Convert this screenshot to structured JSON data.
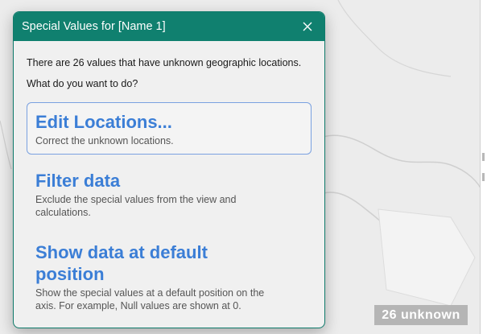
{
  "dialog": {
    "title": "Special Values for [Name 1]",
    "close_icon": "close-icon",
    "message_line1": "There are 26 values that have unknown geographic locations.",
    "message_line2": "What do you want to do?",
    "options": [
      {
        "title": "Edit Locations...",
        "description": "Correct the unknown locations.",
        "selected": true
      },
      {
        "title": "Filter data",
        "description": "Exclude the special values from the view and calculations.",
        "selected": false
      },
      {
        "title": "Show data at default position",
        "description": "Show the special values at a default position on the axis. For example, Null values are shown at 0.",
        "selected": false
      }
    ]
  },
  "map": {
    "unknown_indicator": "26 unknown"
  },
  "colors": {
    "title_bar": "#10806f",
    "option_title": "#3b7ed6",
    "selected_border": "#7aa1e0",
    "badge_bg": "#b5b5b5"
  }
}
